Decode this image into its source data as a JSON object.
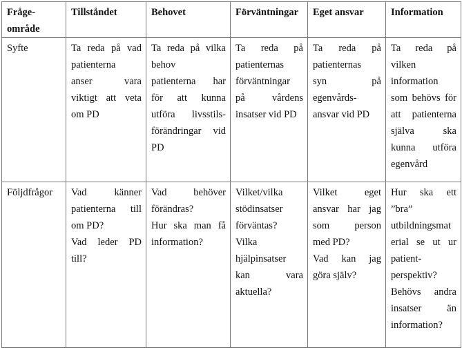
{
  "headers": [
    [
      "Fråge-",
      "område"
    ],
    [
      "Tillståndet"
    ],
    [
      "Behovet"
    ],
    [
      "Förväntningar"
    ],
    [
      "Eget ansvar"
    ],
    [
      "Information"
    ]
  ],
  "rows": [
    {
      "label": "Syfte",
      "cells": [
        [
          "Ta reda på vad",
          "patienterna",
          "anser vara",
          "viktigt att veta",
          "om PD"
        ],
        [
          "Ta reda på vilka",
          "behov",
          "patienterna har",
          "för att kunna",
          "utföra livsstils-",
          "förändringar vid",
          "PD"
        ],
        [
          "Ta reda på",
          "patienternas",
          "förväntningar",
          "på vårdens",
          "insatser vid PD"
        ],
        [
          "Ta reda på",
          "patienternas",
          "syn på",
          "egenvårds-",
          "ansvar vid PD"
        ],
        [
          "Ta reda på",
          "vilken",
          "information",
          "som behövs för",
          "att patienterna",
          "själva ska",
          "kunna utföra",
          "egenvård"
        ]
      ]
    },
    {
      "label": "Följdfrågor",
      "cells": [
        [
          "Vad känner",
          "patienterna till",
          "om PD?",
          "Vad leder PD",
          "till?"
        ],
        [
          "Vad behöver",
          "förändras?",
          "Hur ska man få",
          "information?"
        ],
        [
          "Vilket/vilka",
          "stödinsatser",
          "förväntas?",
          "Vilka",
          "hjälpinsatser",
          "kan vara",
          "aktuella?"
        ],
        [
          "Vilket eget",
          "ansvar har jag",
          "som person",
          "med PD?",
          "Vad kan jag",
          "göra själv?"
        ],
        [
          "Hur ska ett",
          "”bra”",
          "utbildningsmat",
          "erial se ut ur",
          "patient-",
          "perspektiv?",
          "Behövs andra",
          "insatser än",
          "information?"
        ]
      ]
    }
  ]
}
